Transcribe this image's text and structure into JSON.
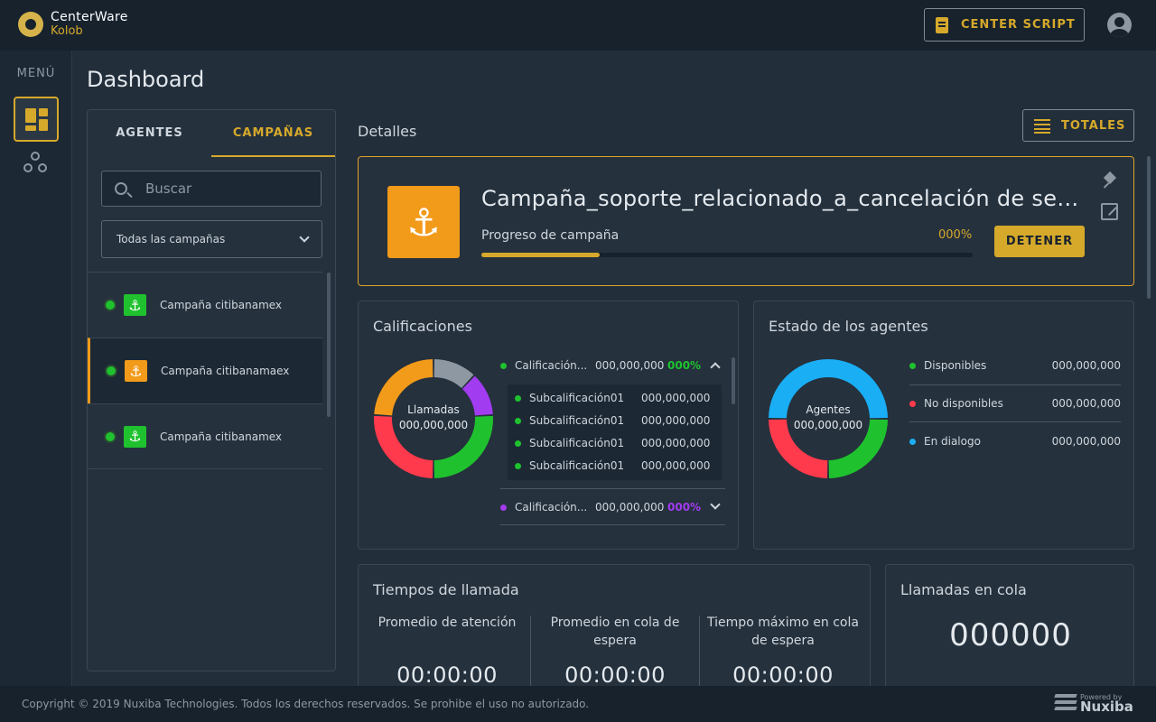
{
  "app": {
    "brand": "CenterWare",
    "product": "Kolob",
    "center_script_label": "CENTER SCRIPT"
  },
  "menu": {
    "label": "MENÚ"
  },
  "page": {
    "title": "Dashboard"
  },
  "campaigns_panel": {
    "tabs": [
      {
        "label": "AGENTES",
        "active": false
      },
      {
        "label": "CAMPAÑAS",
        "active": true
      }
    ],
    "search": {
      "placeholder": "Buscar",
      "value": ""
    },
    "filter": {
      "selected": "Todas las campañas"
    },
    "items": [
      {
        "name": "Campaña citibanamex",
        "status_color": "#1fc22e",
        "icon_color": "#1fc22e",
        "selected": false
      },
      {
        "name": "Campaña citibanamaex",
        "status_color": "#1fc22e",
        "icon_color": "#f29a1a",
        "selected": true
      },
      {
        "name": "Campaña citibanamex",
        "status_color": "#1fc22e",
        "icon_color": "#1fc22e",
        "selected": false
      }
    ]
  },
  "details": {
    "label": "Detalles",
    "totales_label": "TOTALES",
    "campaign": {
      "title": "Campaña_soporte_relacionado_a_cancelación de servicios",
      "progress_label": "Progreso de campaña",
      "progress_pct_text": "000%",
      "progress_fraction": 0.24,
      "stop_label": "DETENER",
      "icon": "anchor-icon"
    }
  },
  "calificaciones": {
    "title": "Calificaciones",
    "center_label": "Llamadas",
    "center_value": "000,000,000",
    "segments": [
      {
        "color": "#8d98a3",
        "value": 12
      },
      {
        "color": "#a23cf0",
        "value": 12
      },
      {
        "color": "#1fc22e",
        "value": 26
      },
      {
        "color": "#ff3a4c",
        "value": 26
      },
      {
        "color": "#f29a1a",
        "value": 24
      }
    ],
    "rows": [
      {
        "label": "Calificación...",
        "value": "000,000,000",
        "pct": "000%",
        "color": "#1fc22e",
        "expanded": true
      },
      {
        "label": "Calificación...",
        "value": "000,000,000",
        "pct": "000%",
        "color": "#a23cf0",
        "expanded": false
      }
    ],
    "subrows": [
      {
        "label": "Subcalificación01",
        "value": "000,000,000"
      },
      {
        "label": "Subcalificación01",
        "value": "000,000,000"
      },
      {
        "label": "Subcalificación01",
        "value": "000,000,000"
      },
      {
        "label": "Subcalificación01",
        "value": "000,000,000"
      }
    ]
  },
  "estado_agentes": {
    "title": "Estado de los agentes",
    "center_label": "Agentes",
    "center_value": "000,000,000",
    "segments": [
      {
        "color": "#1aaef5",
        "value": 50
      },
      {
        "color": "#1fc22e",
        "value": 25
      },
      {
        "color": "#ff3a4c",
        "value": 25
      }
    ],
    "rows": [
      {
        "label": "Disponibles",
        "value": "000,000,000",
        "color": "#1fc22e"
      },
      {
        "label": "No disponibles",
        "value": "000,000,000",
        "color": "#ff3a4c"
      },
      {
        "label": "En dialogo",
        "value": "000,000,000",
        "color": "#1aaef5"
      }
    ]
  },
  "tiempos": {
    "title": "Tiempos de llamada",
    "columns": [
      {
        "label": "Promedio de atención",
        "value": "00:00:00"
      },
      {
        "label": "Promedio en cola de espera",
        "value": "00:00:00"
      },
      {
        "label": "Tiempo máximo en cola de espera",
        "value": "00:00:00"
      }
    ]
  },
  "cola": {
    "title": "Llamadas en cola",
    "value": "000000"
  },
  "footer": {
    "copyright": "Copyright © 2019 Nuxiba Technologies. Todos los derechos reservados. Se prohibe el uso no autorizado.",
    "powered_by": "Powered by",
    "brand": "Nuxiba"
  },
  "colors": {
    "accent": "#d6a92b",
    "orange": "#f29a1a",
    "bg": "#222e3a",
    "panel": "#25313d"
  }
}
